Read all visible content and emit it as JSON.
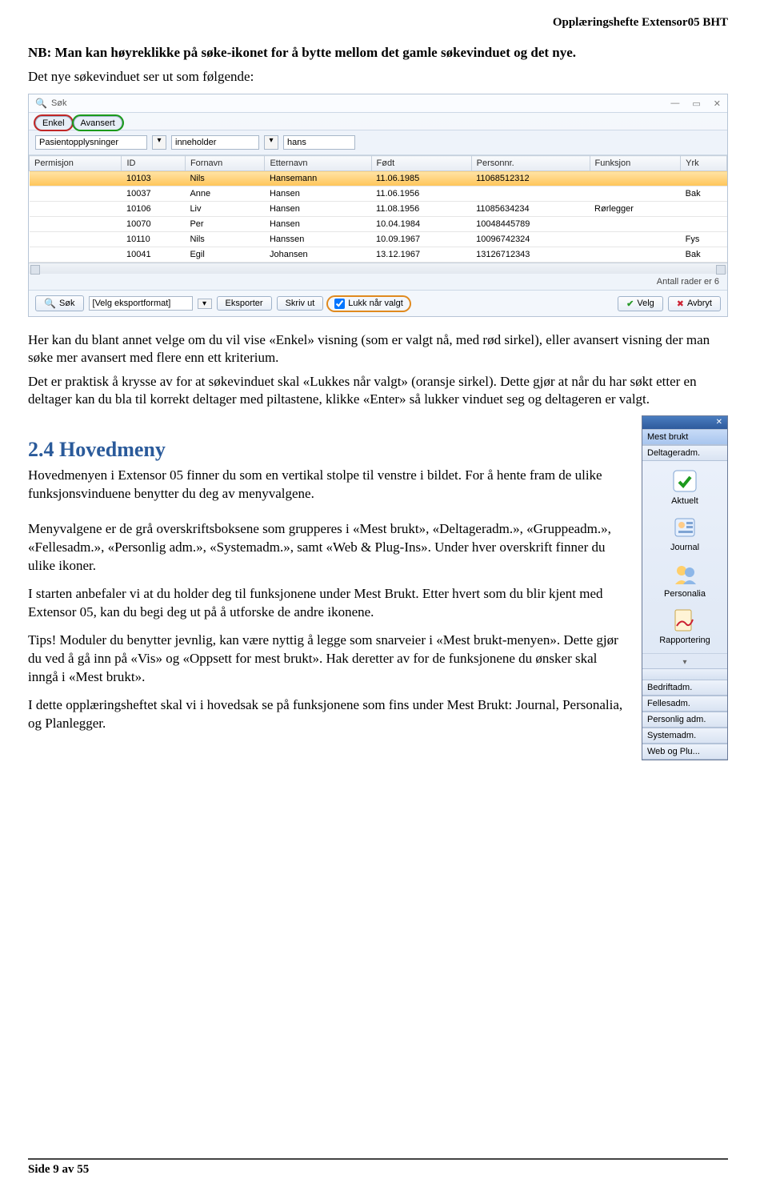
{
  "header": {
    "doc_title": "Opplæringshefte Extensor05 BHT"
  },
  "note": "NB: Man kan høyreklikke på søke-ikonet for å bytte mellom det gamle søkevinduet og det nye.",
  "intro_line": "Det nye søkevinduet ser ut som følgende:",
  "search_window": {
    "title": "Søk",
    "tabs": {
      "simple": "Enkel",
      "advanced": "Avansert"
    },
    "filter": {
      "field": "Pasientopplysninger",
      "operator": "inneholder",
      "value": "hans"
    },
    "columns": [
      "Permisjon",
      "ID",
      "Fornavn",
      "Etternavn",
      "Født",
      "Personnr.",
      "Funksjon",
      "Yrk"
    ],
    "rows": [
      {
        "Permisjon": "",
        "ID": "10103",
        "Fornavn": "Nils",
        "Etternavn": "Hansemann",
        "Født": "11.06.1985",
        "Personnr": "11068512312",
        "Funksjon": "",
        "Yrk": ""
      },
      {
        "Permisjon": "",
        "ID": "10037",
        "Fornavn": "Anne",
        "Etternavn": "Hansen",
        "Født": "11.06.1956",
        "Personnr": "",
        "Funksjon": "",
        "Yrk": "Bak"
      },
      {
        "Permisjon": "",
        "ID": "10106",
        "Fornavn": "Liv",
        "Etternavn": "Hansen",
        "Født": "11.08.1956",
        "Personnr": "11085634234",
        "Funksjon": "Rørlegger",
        "Yrk": ""
      },
      {
        "Permisjon": "",
        "ID": "10070",
        "Fornavn": "Per",
        "Etternavn": "Hansen",
        "Født": "10.04.1984",
        "Personnr": "10048445789",
        "Funksjon": "",
        "Yrk": ""
      },
      {
        "Permisjon": "",
        "ID": "10110",
        "Fornavn": "Nils",
        "Etternavn": "Hanssen",
        "Født": "10.09.1967",
        "Personnr": "10096742324",
        "Funksjon": "",
        "Yrk": "Fys"
      },
      {
        "Permisjon": "",
        "ID": "10041",
        "Fornavn": "Egil",
        "Etternavn": "Johansen",
        "Født": "13.12.1967",
        "Personnr": "13126712343",
        "Funksjon": "",
        "Yrk": "Bak"
      }
    ],
    "row_count": "Antall rader er 6",
    "footer": {
      "search": "Søk",
      "export_select": "[Velg eksportformat]",
      "export": "Eksporter",
      "print": "Skriv ut",
      "close_on_select": "Lukk når valgt",
      "select": "Velg",
      "cancel": "Avbryt"
    }
  },
  "para1": "Her kan du blant annet velge om du vil vise «Enkel» visning (som er valgt nå, med rød sirkel), eller avansert visning der man søke mer avansert med flere enn ett kriterium.",
  "para2": "Det er praktisk å krysse av for at søkevinduet skal «Lukkes når valgt» (oransje sirkel). Dette gjør at når du har søkt etter en deltager kan du bla til korrekt deltager med piltastene, klikke «Enter» så lukker vinduet seg og deltageren er valgt.",
  "section24": {
    "title": "2.4 Hovedmeny",
    "p1": "Hovedmenyen i Extensor 05 finner du som en vertikal stolpe til venstre i bildet. For å hente fram de ulike funksjonsvinduene benytter du deg av menyvalgene.",
    "p2": "Menyvalgene er de grå overskriftsboksene som grupperes i «Mest brukt», «Deltageradm.», «Gruppeadm.», «Fellesadm.», «Personlig adm.», «Systemadm.», samt «Web & Plug-Ins». Under hver overskrift finner du ulike ikoner.",
    "p3": "I starten anbefaler vi at du holder deg til funksjonene under Mest Brukt. Etter hvert som du blir kjent med Extensor 05, kan du begi deg ut på å utforske de andre ikonene.",
    "p4": "Tips! Moduler du benytter jevnlig, kan være nyttig å legge som snarveier i «Mest brukt-menyen». Dette gjør du ved å gå inn på «Vis» og «Oppsett for mest brukt». Hak deretter av for de funksjonene du ønsker skal inngå i «Mest brukt».",
    "p5": "I dette opplæringsheftet skal vi i hovedsak se på funksjonene som fins under Mest Brukt: Journal, Personalia, og Planlegger."
  },
  "menu": {
    "headers": {
      "most_used": "Mest brukt",
      "deltager": "Deltageradm.",
      "bedrift": "Bedriftadm.",
      "felles": "Fellesadm.",
      "personlig": "Personlig adm.",
      "system": "Systemadm.",
      "web": "Web og Plu..."
    },
    "items": {
      "aktuelt": "Aktuelt",
      "journal": "Journal",
      "personalia": "Personalia",
      "rapportering": "Rapportering"
    }
  },
  "footer": {
    "page": "Side 9 av 55"
  }
}
